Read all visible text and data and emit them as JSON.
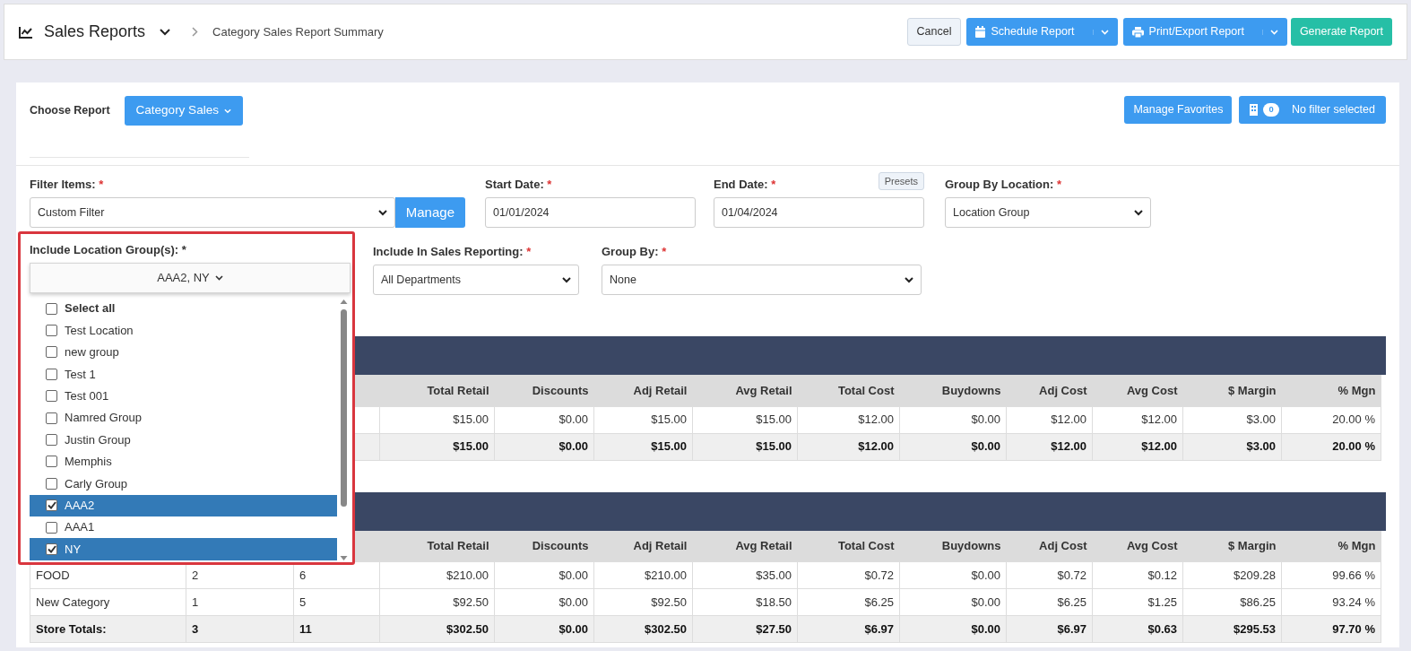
{
  "header": {
    "title": "Sales Reports",
    "breadcrumb": "Category Sales Report Summary",
    "buttons": [
      {
        "label": "Cancel",
        "kind": "plain"
      },
      {
        "label": "Schedule Report",
        "kind": "split"
      },
      {
        "label": "Print/Export Report",
        "kind": "split"
      },
      {
        "label": "Generate Report",
        "kind": "success"
      }
    ]
  },
  "report": {
    "choose_label": "Choose Report",
    "report_button": "Category Sales",
    "favorites_button": "Manage Favorites",
    "filter_count": "0",
    "filter_text": "No filter selected"
  },
  "filters": {
    "filter_items": {
      "label": "Filter Items:",
      "required_mark": "*",
      "value": "Custom Filter",
      "manage": "Manage"
    },
    "start_date": {
      "label": "Start Date:",
      "required_mark": "*",
      "value": "01/01/2024"
    },
    "end_date": {
      "label": "End Date:",
      "required_mark": "*",
      "value": "01/04/2024",
      "presets": "Presets"
    },
    "group_by_location": {
      "label": "Group By Location:",
      "required_mark": "*",
      "value": "Location Group"
    },
    "location_groups": {
      "label": "Include Location Group(s): *",
      "value": "AAA2, NY",
      "expanded": true,
      "options": [
        {
          "label": "Select all",
          "kind": "select_all",
          "checked": false
        },
        {
          "label": "Test Location",
          "kind": "option",
          "checked": false
        },
        {
          "label": "new group",
          "kind": "option",
          "checked": false
        },
        {
          "label": "Test 1",
          "kind": "option",
          "checked": false
        },
        {
          "label": "Test 001",
          "kind": "option",
          "checked": false
        },
        {
          "label": "Namred Group",
          "kind": "option",
          "checked": false
        },
        {
          "label": "Justin Group",
          "kind": "option",
          "checked": false
        },
        {
          "label": "Memphis",
          "kind": "option",
          "checked": false
        },
        {
          "label": "Carly Group",
          "kind": "option",
          "checked": false
        },
        {
          "label": "AAA2",
          "kind": "option",
          "checked": true
        },
        {
          "label": "AAA1",
          "kind": "option",
          "checked": false
        },
        {
          "label": "NY",
          "kind": "option",
          "checked": true
        }
      ]
    },
    "include_sales": {
      "label": "Include In Sales Reporting:",
      "required_mark": "*",
      "value": "All Departments"
    },
    "group_by": {
      "label": "Group By:",
      "required_mark": "*",
      "value": "None"
    }
  },
  "tables": [
    {
      "columns": [
        "Total Retail",
        "Discounts",
        "Adj Retail",
        "Avg Retail",
        "Total Cost",
        "Buydowns",
        "Adj Cost",
        "Avg Cost",
        "$ Margin",
        "% Mgn"
      ],
      "rows": [
        {
          "kind": "data",
          "cells": [
            "$15.00",
            "$0.00",
            "$15.00",
            "$15.00",
            "$12.00",
            "$0.00",
            "$12.00",
            "$12.00",
            "$3.00",
            "20.00 %"
          ]
        },
        {
          "kind": "total",
          "cells": [
            "$15.00",
            "$0.00",
            "$15.00",
            "$15.00",
            "$12.00",
            "$0.00",
            "$12.00",
            "$12.00",
            "$3.00",
            "20.00 %"
          ]
        }
      ]
    },
    {
      "columns": [
        "",
        "",
        "",
        "Total Retail",
        "Discounts",
        "Adj Retail",
        "Avg Retail",
        "Total Cost",
        "Buydowns",
        "Adj Cost",
        "Avg Cost",
        "$ Margin",
        "% Mgn"
      ],
      "rows": [
        {
          "kind": "data",
          "cells": [
            "FOOD",
            "2",
            "6",
            "$210.00",
            "$0.00",
            "$210.00",
            "$35.00",
            "$0.72",
            "$0.00",
            "$0.72",
            "$0.12",
            "$209.28",
            "99.66 %"
          ]
        },
        {
          "kind": "data",
          "cells": [
            "New Category",
            "1",
            "5",
            "$92.50",
            "$0.00",
            "$92.50",
            "$18.50",
            "$6.25",
            "$0.00",
            "$6.25",
            "$1.25",
            "$86.25",
            "93.24 %"
          ]
        },
        {
          "kind": "total",
          "cells": [
            "Store Totals:",
            "3",
            "11",
            "$302.50",
            "$0.00",
            "$302.50",
            "$27.50",
            "$6.97",
            "$0.00",
            "$6.97",
            "$0.63",
            "$295.53",
            "97.70 %"
          ]
        }
      ]
    }
  ]
}
